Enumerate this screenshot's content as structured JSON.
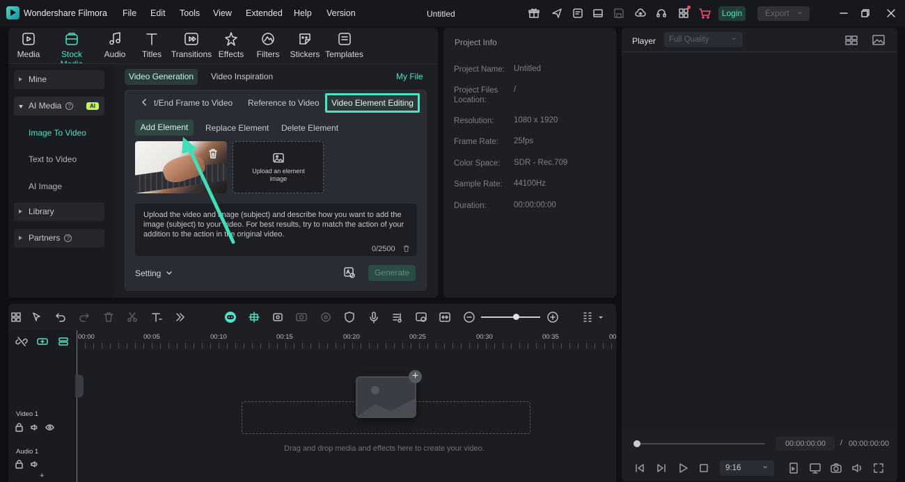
{
  "app": {
    "name": "Wondershare Filmora",
    "doc_title": "Untitled"
  },
  "menu": [
    "File",
    "Edit",
    "Tools",
    "View",
    "Extended",
    "Help",
    "Version"
  ],
  "titlebar": {
    "login": "Login",
    "export": "Export"
  },
  "media_tabs": [
    {
      "label": "Media",
      "icon": "media-icon"
    },
    {
      "label": "Stock Media",
      "icon": "stock-media-icon"
    },
    {
      "label": "Audio",
      "icon": "audio-icon"
    },
    {
      "label": "Titles",
      "icon": "titles-icon"
    },
    {
      "label": "Transitions",
      "icon": "transitions-icon"
    },
    {
      "label": "Effects",
      "icon": "effects-icon"
    },
    {
      "label": "Filters",
      "icon": "filters-icon"
    },
    {
      "label": "Stickers",
      "icon": "stickers-icon"
    },
    {
      "label": "Templates",
      "icon": "templates-icon"
    }
  ],
  "sidebar": {
    "mine": "Mine",
    "ai_media": "AI Media",
    "ai_badge": "AI",
    "sub": [
      "Image To Video",
      "Text to Video",
      "AI Image"
    ],
    "library": "Library",
    "partners": "Partners"
  },
  "gen": {
    "subtabs": [
      "Video Generation",
      "Video Inspiration"
    ],
    "my_file": "My File",
    "mode_tabs": [
      "t/End Frame to Video",
      "Reference to Video",
      "Video Element Editing"
    ],
    "actions": [
      "Add Element",
      "Replace Element",
      "Delete Element"
    ],
    "upload_label": "Upload an element image",
    "prompt": "Upload the video and image (subject) and describe how you want to add the image (subject) to your video. For best results, try to match the action of your addition to the action in the original video.",
    "char_count": "0/2500",
    "setting": "Setting",
    "generate": "Generate"
  },
  "project_info": {
    "title": "Project Info",
    "rows": [
      {
        "k": "Project Name:",
        "v": "Untitled"
      },
      {
        "k": "Project Files Location:",
        "v": "/"
      },
      {
        "k": "Resolution:",
        "v": "1080 x 1920"
      },
      {
        "k": "Frame Rate:",
        "v": "25fps"
      },
      {
        "k": "Color Space:",
        "v": "SDR - Rec.709"
      },
      {
        "k": "Sample Rate:",
        "v": "44100Hz"
      },
      {
        "k": "Duration:",
        "v": "00:00:00:00"
      }
    ]
  },
  "player": {
    "label": "Player",
    "quality": "Full Quality",
    "current_time": "00:00:00:00",
    "separator": "/",
    "total_time": "00:00:00:00",
    "ratio": "9:16",
    "progress": 0
  },
  "timeline": {
    "ticks": [
      "00:00",
      "00:05",
      "00:10",
      "00:15",
      "00:20",
      "00:25",
      "00:30",
      "00:35",
      "00"
    ],
    "tracks": [
      "Video 1",
      "Audio 1"
    ],
    "drop_text": "Drag and drop media and effects here to create your video."
  },
  "colors": {
    "accent": "#4fe2c2",
    "highlight_border": "#49e5c4",
    "badge": "#c6f35b"
  }
}
